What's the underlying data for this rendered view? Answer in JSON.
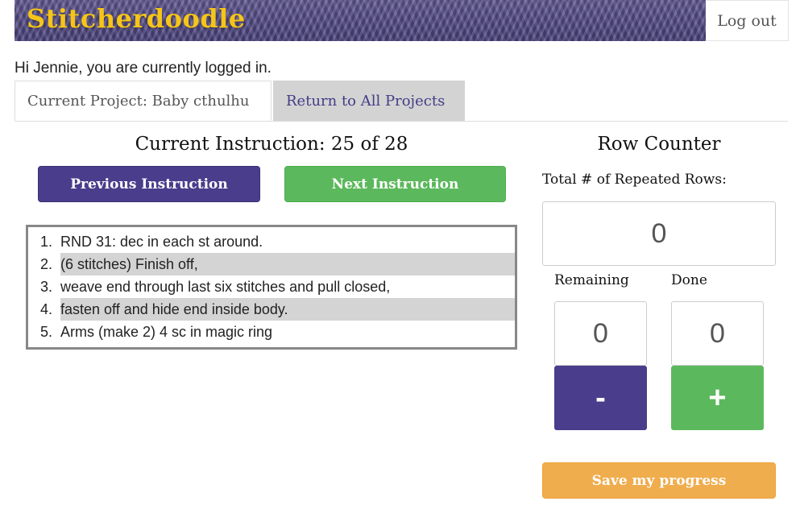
{
  "header": {
    "brand": "Stitcherdoodle",
    "logout_label": "Log out"
  },
  "greeting": "Hi Jennie, you are currently logged in.",
  "tabs": [
    {
      "label": "Current Project: Baby cthulhu",
      "active": true
    },
    {
      "label": "Return to All Projects",
      "active": false
    }
  ],
  "instructions": {
    "title": "Current Instruction: 25 of 28",
    "prev_label": "Previous Instruction",
    "next_label": "Next Instruction",
    "items": [
      {
        "num": "1.",
        "text": "RND 31: dec in each st around.",
        "highlighted": false
      },
      {
        "num": "2.",
        "text": "(6 stitches) Finish off,",
        "highlighted": true
      },
      {
        "num": "3.",
        "text": "weave end through last six stitches and pull closed,",
        "highlighted": false
      },
      {
        "num": "4.",
        "text": "fasten off and hide end inside body.",
        "highlighted": true
      },
      {
        "num": "5.",
        "text": "Arms (make 2) 4 sc in magic ring",
        "highlighted": false
      }
    ]
  },
  "row_counter": {
    "title": "Row Counter",
    "total_label": "Total # of Repeated Rows:",
    "total_value": "0",
    "remaining_label": "Remaining",
    "remaining_value": "0",
    "done_label": "Done",
    "done_value": "0",
    "minus_label": "-",
    "plus_label": "+",
    "save_label": "Save my progress"
  },
  "colors": {
    "brand_yellow": "#f5c518",
    "primary_purple": "#4a3d8c",
    "success_green": "#5cb85c",
    "warning_orange": "#f0ad4e",
    "tab_inactive_bg": "#d3d3d3"
  }
}
